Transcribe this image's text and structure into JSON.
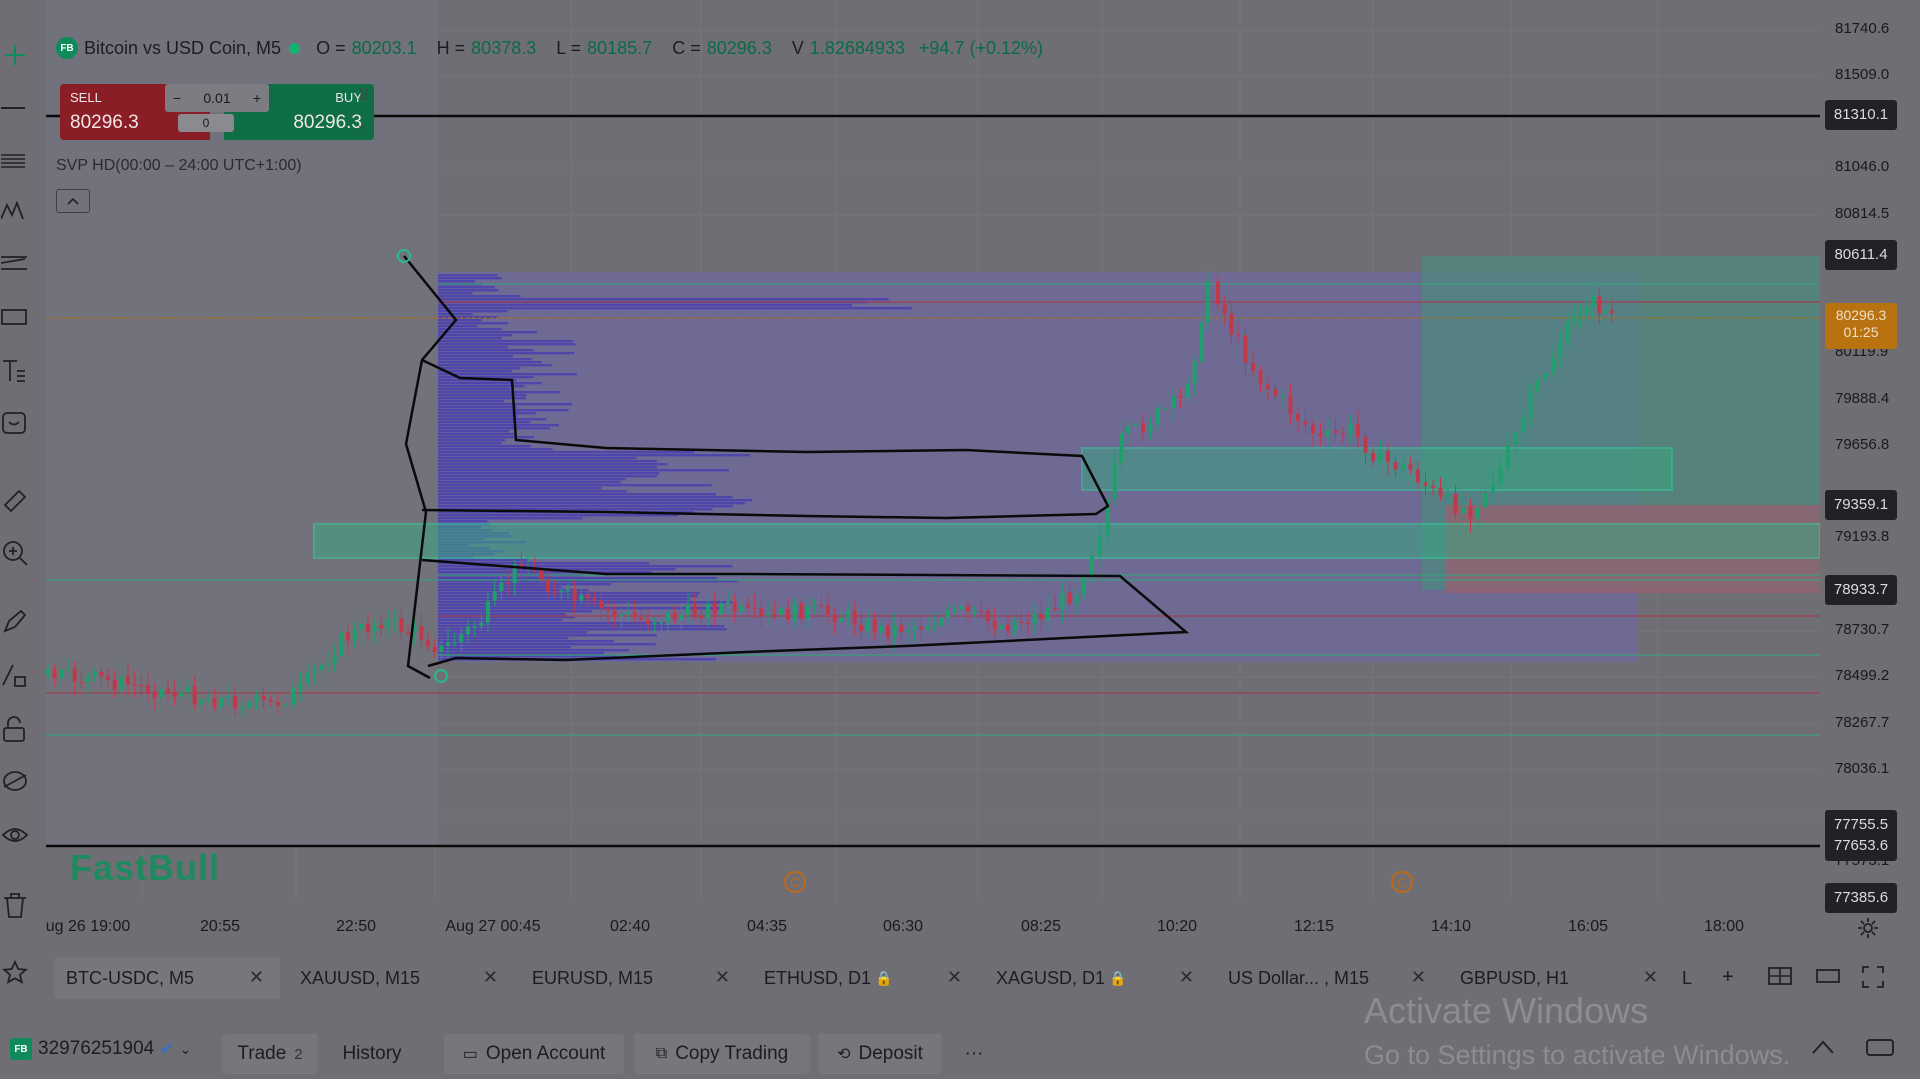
{
  "symbol": {
    "badge": "FB",
    "name": "Bitcoin vs USD Coin, M5",
    "ohlc": [
      {
        "k": "O =",
        "v": "80203.1"
      },
      {
        "k": "H =",
        "v": "80378.3"
      },
      {
        "k": "L =",
        "v": "80185.7"
      },
      {
        "k": "C =",
        "v": "80296.3"
      },
      {
        "k": "V",
        "v": "1.82684933"
      }
    ],
    "change": "+94.7 (+0.12%)"
  },
  "trade_widget": {
    "sell_label": "SELL",
    "buy_label": "BUY",
    "sell_price": "80296.3",
    "buy_price": "80296.3",
    "qty": "0.01",
    "qty_minus": "−",
    "qty_plus": "+",
    "spread": "0"
  },
  "indicator_label": "SVP HD(00:00 – 24:00 UTC+1:00)",
  "watermark": "FastBull",
  "price_axis": {
    "ticks": [
      "81740.6",
      "81509.0",
      "81046.0",
      "80814.5",
      "80119.9",
      "79888.4",
      "79656.8",
      "79193.8",
      "78730.7",
      "78499.2",
      "78267.7",
      "78036.1",
      "77573.1"
    ],
    "labels_dark": [
      "81310.1",
      "80611.4",
      "79359.1",
      "78933.7",
      "77755.5",
      "77653.6",
      "77385.6"
    ],
    "current_price": "80296.3",
    "countdown": "01:25"
  },
  "time_axis": [
    "ug 26 19:00",
    "20:55",
    "22:50",
    "Aug 27 00:45",
    "02:40",
    "04:35",
    "06:30",
    "08:25",
    "10:20",
    "12:15",
    "14:10",
    "16:05",
    "18:00"
  ],
  "tabs": [
    {
      "label": "BTC-USDC, M5",
      "active": true
    },
    {
      "label": "XAUUSD, M15",
      "active": false
    },
    {
      "label": "EURUSD, M15",
      "active": false
    },
    {
      "label": "ETHUSD, D1",
      "active": false,
      "locked": true
    },
    {
      "label": "XAGUSD, D1",
      "active": false,
      "locked": true
    },
    {
      "label": "US Dollar... , M15",
      "active": false
    },
    {
      "label": "GBPUSD, H1",
      "active": false
    },
    {
      "label": "L",
      "active": false
    }
  ],
  "bottom": {
    "account": "32976251904",
    "trade_label": "Trade",
    "trade_count": "2",
    "history_label": "History",
    "open_account_label": "Open Account",
    "copy_trading_label": "Copy Trading",
    "deposit_label": "Deposit",
    "more_label": "···"
  },
  "activation": {
    "title": "Activate Windows",
    "subtitle": "Go to Settings to activate Windows."
  },
  "colors": {
    "background": "#6e6e74",
    "bull": "#1f9e6e",
    "bear": "#c0394a",
    "volume_profile": "#4a3fb0",
    "zone_green": "#2aa37a",
    "current_price": "#b8720f"
  }
}
